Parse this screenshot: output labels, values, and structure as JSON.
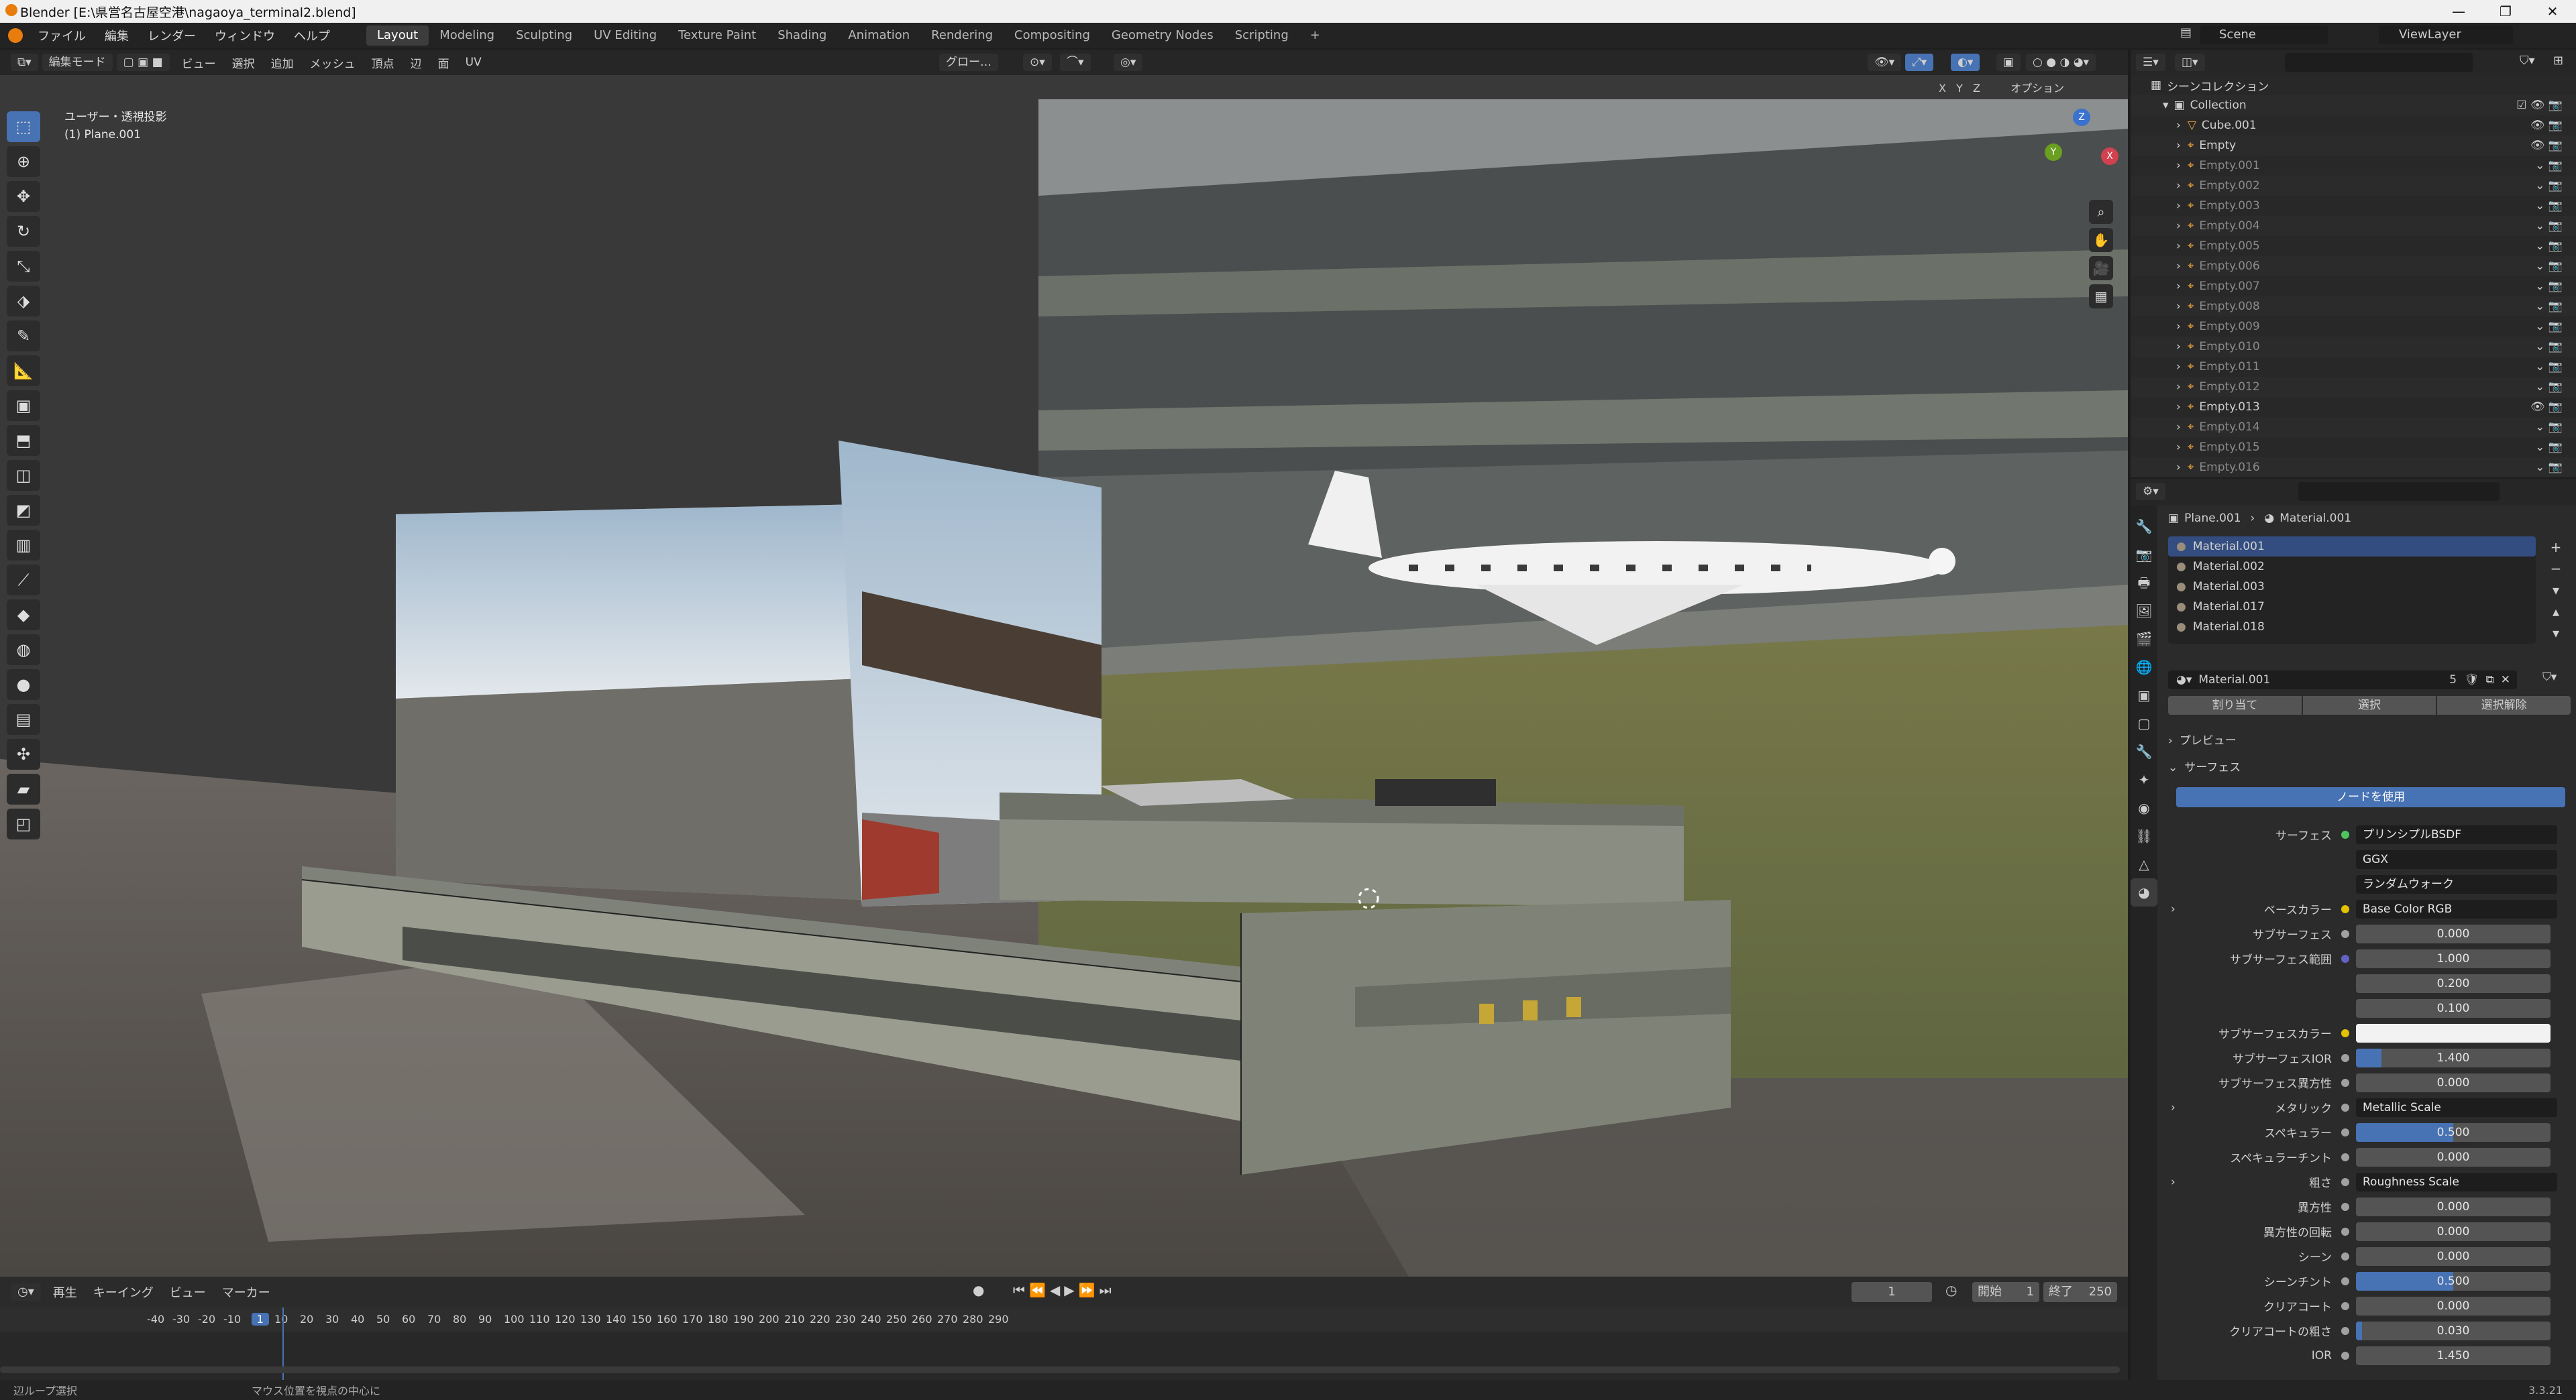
{
  "titlebar": {
    "title": "Blender [E:\\県営名古屋空港\\nagaoya_terminal2.blend]"
  },
  "topmenu": {
    "items": [
      "ファイル",
      "編集",
      "レンダー",
      "ウィンドウ",
      "ヘルプ"
    ],
    "workspaces": [
      "Layout",
      "Modeling",
      "Sculpting",
      "UV Editing",
      "Texture Paint",
      "Shading",
      "Animation",
      "Rendering",
      "Compositing",
      "Geometry Nodes",
      "Scripting"
    ],
    "active_workspace": "Layout",
    "scene_name": "Scene",
    "view_layer": "ViewLayer"
  },
  "viewport_header": {
    "mode": "編集モード",
    "menus": [
      "ビュー",
      "選択",
      "追加",
      "メッシュ",
      "頂点",
      "辺",
      "面",
      "UV"
    ],
    "transform_orientation": "グロー…",
    "axes": [
      "X",
      "Y",
      "Z"
    ],
    "options": "オプション"
  },
  "viewport": {
    "view_name": "ユーザー・透視投影",
    "object_name": "(1) Plane.001",
    "gizmo_axes": [
      "X",
      "Y",
      "Z"
    ]
  },
  "toolbar": {
    "tools": [
      "select-box-tool",
      "cursor-tool",
      "move-tool",
      "rotate-tool",
      "scale-tool",
      "transform-tool",
      "annotate-tool",
      "measure-tool",
      "add-cube-tool",
      "extrude-tool",
      "inset-tool",
      "bevel-tool",
      "loop-cut-tool",
      "knife-tool",
      "poly-build-tool",
      "spin-tool",
      "smooth-tool",
      "edge-slide-tool",
      "shrink-fatten-tool",
      "shear-tool",
      "rip-tool"
    ]
  },
  "outliner": {
    "root": "シーンコレクション",
    "collection": "Collection",
    "items": [
      "Cube.001",
      "Empty",
      "Empty.001",
      "Empty.002",
      "Empty.003",
      "Empty.004",
      "Empty.005",
      "Empty.006",
      "Empty.007",
      "Empty.008",
      "Empty.009",
      "Empty.010",
      "Empty.011",
      "Empty.012",
      "Empty.013",
      "Empty.014",
      "Empty.015",
      "Empty.016"
    ]
  },
  "properties": {
    "breadcrumb_object": "Plane.001",
    "breadcrumb_material": "Material.001",
    "material_slots": [
      "Material.001",
      "Material.002",
      "Material.003",
      "Material.017",
      "Material.018"
    ],
    "active_material": "Material.001",
    "user_count": "5",
    "assign_button": "割り当て",
    "select_button": "選択",
    "deselect_button": "選択解除",
    "preview_panel": "プレビュー",
    "surface_panel": "サーフェス",
    "use_nodes_button": "ノードを使用",
    "surface_label": "サーフェス",
    "surface_value": "プリンシプルBSDF",
    "distribution": "GGX",
    "subsurface_method": "ランダムウォーク",
    "rows": [
      {
        "label": "ベースカラー",
        "value": "Base Color RGB",
        "kind": "link",
        "dot": "#e3c200"
      },
      {
        "label": "サブサーフェス",
        "value": "0.000",
        "kind": "num",
        "dot": "#a1a1a1",
        "fill": 0
      },
      {
        "label": "サブサーフェス範囲",
        "value": "1.000",
        "kind": "num",
        "dot": "#6363c7",
        "fill": 0
      },
      {
        "label": "",
        "value": "0.200",
        "kind": "num",
        "dot": "",
        "fill": 0
      },
      {
        "label": "",
        "value": "0.100",
        "kind": "num",
        "dot": "",
        "fill": 0
      },
      {
        "label": "サブサーフェスカラー",
        "value": "",
        "kind": "color",
        "dot": "#e3c200"
      },
      {
        "label": "サブサーフェスIOR",
        "value": "1.400",
        "kind": "num",
        "dot": "#a1a1a1",
        "fill": 0.13
      },
      {
        "label": "サブサーフェス異方性",
        "value": "0.000",
        "kind": "num",
        "dot": "#a1a1a1",
        "fill": 0
      },
      {
        "label": "メタリック",
        "value": "Metallic Scale",
        "kind": "link",
        "dot": "#a1a1a1"
      },
      {
        "label": "スペキュラー",
        "value": "0.500",
        "kind": "num",
        "dot": "#a1a1a1",
        "fill": 0.5
      },
      {
        "label": "スペキュラーチント",
        "value": "0.000",
        "kind": "num",
        "dot": "#a1a1a1",
        "fill": 0
      },
      {
        "label": "粗さ",
        "value": "Roughness Scale",
        "kind": "link",
        "dot": "#a1a1a1"
      },
      {
        "label": "異方性",
        "value": "0.000",
        "kind": "num",
        "dot": "#a1a1a1",
        "fill": 0
      },
      {
        "label": "異方性の回転",
        "value": "0.000",
        "kind": "num",
        "dot": "#a1a1a1",
        "fill": 0
      },
      {
        "label": "シーン",
        "value": "0.000",
        "kind": "num",
        "dot": "#a1a1a1",
        "fill": 0
      },
      {
        "label": "シーンチント",
        "value": "0.500",
        "kind": "num",
        "dot": "#a1a1a1",
        "fill": 0.5
      },
      {
        "label": "クリアコート",
        "value": "0.000",
        "kind": "num",
        "dot": "#a1a1a1",
        "fill": 0
      },
      {
        "label": "クリアコートの粗さ",
        "value": "0.030",
        "kind": "num",
        "dot": "#a1a1a1",
        "fill": 0.03
      },
      {
        "label": "IOR",
        "value": "1.450",
        "kind": "num",
        "dot": "#a1a1a1",
        "fill": 0
      }
    ]
  },
  "timeline": {
    "menus": [
      "再生",
      "キーイング",
      "ビュー",
      "マーカー"
    ],
    "current_frame": "1",
    "start_label": "開始",
    "start_value": "1",
    "end_label": "終了",
    "end_value": "250",
    "ruler": [
      "-40",
      "-30",
      "-20",
      "-10",
      "1",
      "10",
      "20",
      "30",
      "40",
      "50",
      "60",
      "70",
      "80",
      "90",
      "100",
      "110",
      "120",
      "130",
      "140",
      "150",
      "160",
      "170",
      "180",
      "190",
      "200",
      "210",
      "220",
      "230",
      "240",
      "250",
      "260",
      "270",
      "280",
      "290"
    ]
  },
  "statusbar": {
    "left": "辺ループ選択",
    "middle": "マウス位置を視点の中心に",
    "version": "3.3.21"
  }
}
